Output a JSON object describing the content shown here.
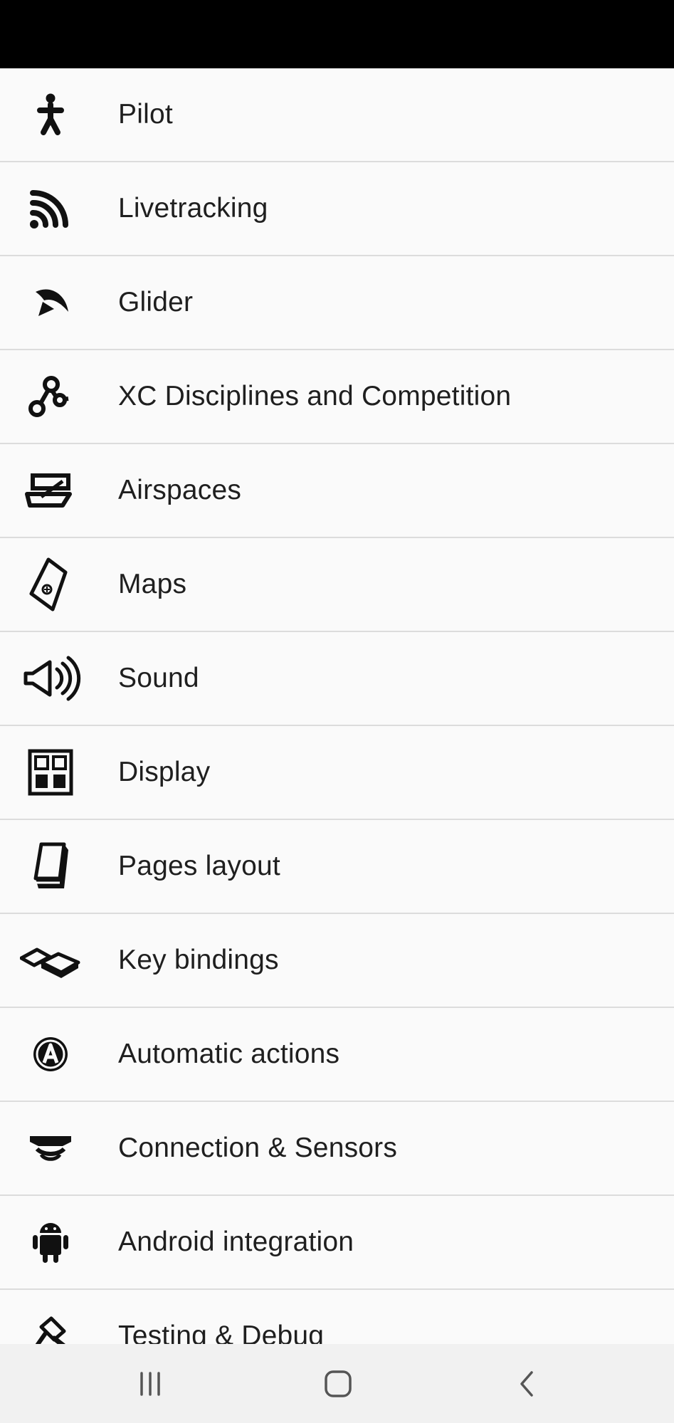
{
  "menu": {
    "items": [
      {
        "label": "Pilot",
        "icon": "pilot-icon"
      },
      {
        "label": "Livetracking",
        "icon": "livetracking-icon"
      },
      {
        "label": "Glider",
        "icon": "glider-icon"
      },
      {
        "label": "XC Disciplines and Competition",
        "icon": "xc-competition-icon"
      },
      {
        "label": "Airspaces",
        "icon": "airspaces-icon"
      },
      {
        "label": "Maps",
        "icon": "maps-icon"
      },
      {
        "label": "Sound",
        "icon": "sound-icon"
      },
      {
        "label": "Display",
        "icon": "display-icon"
      },
      {
        "label": "Pages layout",
        "icon": "pages-layout-icon"
      },
      {
        "label": "Key bindings",
        "icon": "key-bindings-icon"
      },
      {
        "label": "Automatic actions",
        "icon": "automatic-actions-icon"
      },
      {
        "label": "Connection & Sensors",
        "icon": "connection-sensors-icon"
      },
      {
        "label": "Android integration",
        "icon": "android-icon"
      },
      {
        "label": "Testing & Debug",
        "icon": "testing-debug-icon"
      }
    ]
  },
  "navbar": {
    "buttons": [
      "recent-apps-icon",
      "home-icon",
      "back-icon"
    ]
  },
  "colors": {
    "background": "#fafafa",
    "status_bar": "#000000",
    "divider": "#dcdcdc",
    "text": "#1f1f1f",
    "nav_bar": "#f1f1f1"
  }
}
